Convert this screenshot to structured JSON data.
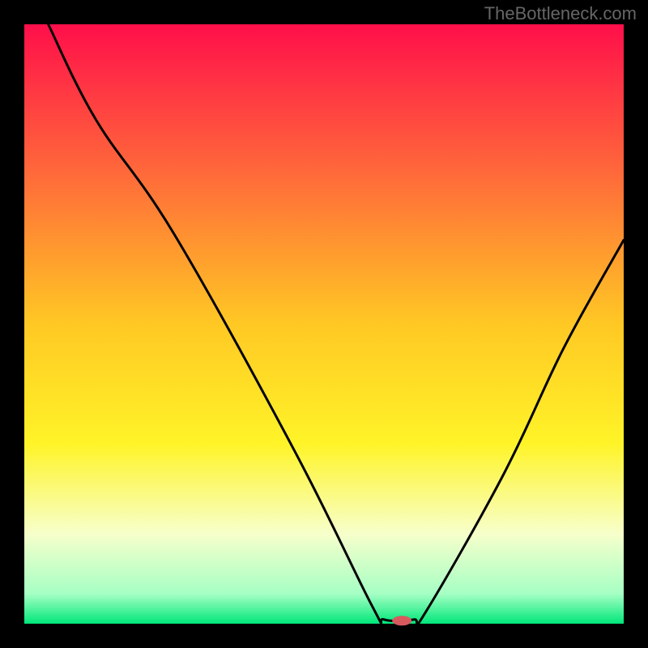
{
  "watermark": "TheBottleneck.com",
  "chart_data": {
    "type": "line",
    "title": "",
    "xlabel": "",
    "ylabel": "",
    "xlim": [
      0,
      100
    ],
    "ylim": [
      0,
      100
    ],
    "background": {
      "stops": [
        {
          "offset": 0,
          "color": "#ff0f4a"
        },
        {
          "offset": 25,
          "color": "#ff6a3a"
        },
        {
          "offset": 50,
          "color": "#ffc824"
        },
        {
          "offset": 70,
          "color": "#fff428"
        },
        {
          "offset": 85,
          "color": "#f7ffcb"
        },
        {
          "offset": 95,
          "color": "#a6ffc4"
        },
        {
          "offset": 100,
          "color": "#00e77a"
        }
      ]
    },
    "series": [
      {
        "name": "bottleneck-curve",
        "points": [
          {
            "x": 4,
            "y": 100
          },
          {
            "x": 12,
            "y": 84
          },
          {
            "x": 25,
            "y": 65
          },
          {
            "x": 45,
            "y": 29
          },
          {
            "x": 58,
            "y": 3
          },
          {
            "x": 60,
            "y": 0.7
          },
          {
            "x": 65,
            "y": 0.7
          },
          {
            "x": 67,
            "y": 2
          },
          {
            "x": 80,
            "y": 25
          },
          {
            "x": 90,
            "y": 46
          },
          {
            "x": 100,
            "y": 64
          }
        ]
      }
    ],
    "marker": {
      "x": 63,
      "y": 0.5,
      "color": "#d85a5f",
      "rx": 12,
      "ry": 6
    },
    "border_color": "#000000",
    "border_width": 30,
    "line_color": "#000000",
    "line_width": 3
  }
}
